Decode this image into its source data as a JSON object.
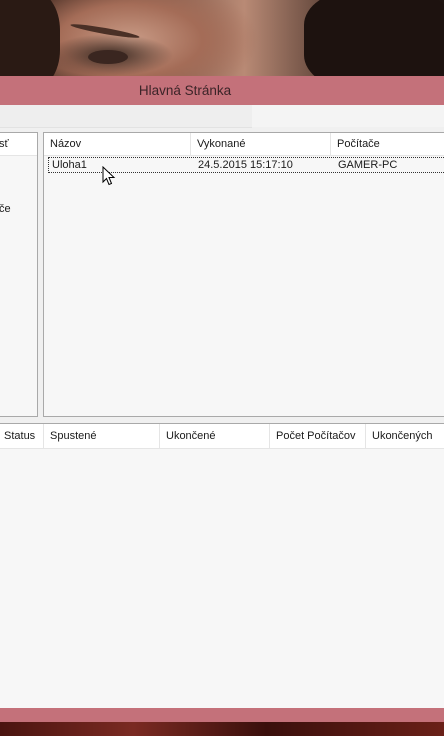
{
  "window": {
    "title": "Hlavná Stránka",
    "accent_color": "#c4717a"
  },
  "left_panel": {
    "header": "sť",
    "item": "če"
  },
  "tasks_table": {
    "columns": [
      "Názov",
      "Vykonané",
      "Počítače"
    ],
    "rows": [
      {
        "name": "Uloha1",
        "executed": "24.5.2015 15:17:10",
        "computers": "GAMER-PC"
      }
    ]
  },
  "runs_table": {
    "columns": [
      "Status",
      "Spustené",
      "Ukončené",
      "Počet Počítačov",
      "Ukončených"
    ]
  },
  "icons": {
    "cursor": "mouse-pointer-icon"
  }
}
